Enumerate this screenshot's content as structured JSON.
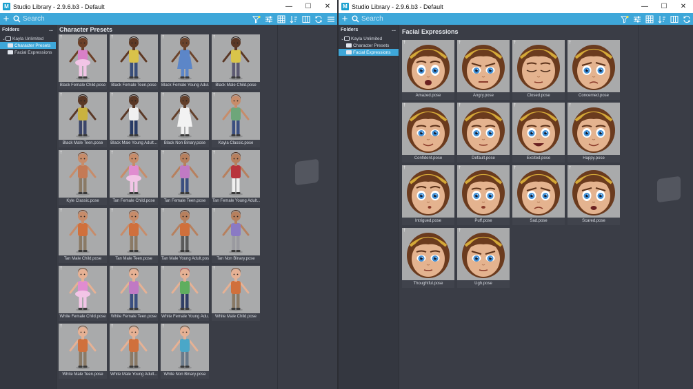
{
  "left_window": {
    "title": "Studio Library - 2.9.6.b3 - Default",
    "app_icon_letter": "M",
    "search_placeholder": "Search",
    "sidebar": {
      "heading": "Folders",
      "more": "...",
      "items": [
        {
          "label": "Kayla Unlimited",
          "expand": "⌄",
          "selected": false
        },
        {
          "label": "Character Presets",
          "selected": true
        },
        {
          "label": "Facial Expressions",
          "selected": false
        }
      ]
    },
    "main_title": "Character Presets",
    "items": [
      {
        "label": "Black Female Child.pose",
        "skin": "#6b3f27",
        "shirt": "#d880c7",
        "pants": "#f2c5e6",
        "hair": "#1a1210",
        "style": "tutu"
      },
      {
        "label": "Black Female Teen.pose",
        "skin": "#5e3823",
        "shirt": "#d9c24a",
        "pants": "#3a4f7a",
        "hair": "#1a1210",
        "style": "plain"
      },
      {
        "label": "Black Female Young Adul...",
        "skin": "#6b432b",
        "shirt": "#5c86c8",
        "pants": "#5c86c8",
        "hair": "#1a1210",
        "style": "dress"
      },
      {
        "label": "Black Male Child.pose",
        "skin": "#5a3826",
        "shirt": "#d9c44a",
        "pants": "#5d5a72",
        "hair": "#1a1210",
        "style": "plain"
      },
      {
        "label": "Black Male Teen.pose",
        "skin": "#5a3826",
        "shirt": "#c9b240",
        "pants": "#3b456a",
        "hair": "#1a1210",
        "style": "plain"
      },
      {
        "label": "Black Male Young Adult...",
        "skin": "#5a3826",
        "shirt": "#f0f0f0",
        "pants": "#283b66",
        "hair": "#1a1210",
        "style": "plain"
      },
      {
        "label": "Black Non Binary.pose",
        "skin": "#63402b",
        "shirt": "#f2f2f2",
        "pants": "#f2f2f2",
        "hair": "#1a1210",
        "style": "dress"
      },
      {
        "label": "Kayla Classic.pose",
        "skin": "#c78c6a",
        "shirt": "#6ea67a",
        "pants": "#3b4f80",
        "hair": "#6a3b22",
        "style": "plain"
      },
      {
        "label": "Kyle Classic.pose",
        "skin": "#c78c6a",
        "shirt": "#c47a56",
        "pants": "#8a7a66",
        "hair": "#6a3b22",
        "style": "plain"
      },
      {
        "label": "Tan Female Child.pose",
        "skin": "#c78c6a",
        "shirt": "#e08cd0",
        "pants": "#f2c5e6",
        "hair": "#6a3b22",
        "style": "tutu"
      },
      {
        "label": "Tan Female Teen.pose",
        "skin": "#b7805e",
        "shirt": "#c07ac4",
        "pants": "#3b4f80",
        "hair": "#5a3421",
        "style": "plain"
      },
      {
        "label": "Tan Female Young Adult...",
        "skin": "#b7805e",
        "shirt": "#b8343c",
        "pants": "#f0f0f0",
        "hair": "#4a2a1a",
        "style": "plain"
      },
      {
        "label": "Tan Male Child.pose",
        "skin": "#c78c6a",
        "shirt": "#d0703c",
        "pants": "#8a7a66",
        "hair": "#6a3b22",
        "style": "plain"
      },
      {
        "label": "Tan Male Teen.pose",
        "skin": "#c78c6a",
        "shirt": "#d0703c",
        "pants": "#8a7a66",
        "hair": "#6a3b22",
        "style": "plain"
      },
      {
        "label": "Tan Male Young Adult.pose",
        "skin": "#b7805e",
        "shirt": "#d0703c",
        "pants": "#5a5a5a",
        "hair": "#4a2a1a",
        "style": "plain"
      },
      {
        "label": "Tan Non Binary.pose",
        "skin": "#b7805e",
        "shirt": "#8a7ac4",
        "pants": "#9a9aa0",
        "hair": "#4a2a1a",
        "style": "plain"
      },
      {
        "label": "White Female Child.pose",
        "skin": "#e6b194",
        "shirt": "#e08cd0",
        "pants": "#f2c5e6",
        "hair": "#7a4a2a",
        "style": "tutu"
      },
      {
        "label": "White Female Teen.pose",
        "skin": "#e6b194",
        "shirt": "#c07ac4",
        "pants": "#3b4f80",
        "hair": "#7a4a2a",
        "style": "plain"
      },
      {
        "label": "White Female Young Adu...",
        "skin": "#e6b194",
        "shirt": "#5fae5f",
        "pants": "#2f3e66",
        "hair": "#c8483c",
        "style": "plain"
      },
      {
        "label": "White Male Child.pose",
        "skin": "#e6b194",
        "shirt": "#d0703c",
        "pants": "#8a7a66",
        "hair": "#7a4a2a",
        "style": "plain"
      },
      {
        "label": "White Male Teen.pose",
        "skin": "#e6b194",
        "shirt": "#d0703c",
        "pants": "#8a7a66",
        "hair": "#7a4a2a",
        "style": "plain"
      },
      {
        "label": "White Male Young Adult...",
        "skin": "#e6b194",
        "shirt": "#d0703c",
        "pants": "#8a7a66",
        "hair": "#7a4a2a",
        "style": "plain"
      },
      {
        "label": "White Non Binary.pose",
        "skin": "#e6b194",
        "shirt": "#4aa7c8",
        "pants": "#6a7a8a",
        "hair": "#7a4a2a",
        "style": "plain"
      }
    ]
  },
  "right_window": {
    "title": "Studio Library - 2.9.6.b3 - Default",
    "app_icon_letter": "M",
    "search_placeholder": "Search",
    "sidebar": {
      "heading": "Folders",
      "more": "...",
      "items": [
        {
          "label": "Kayla Unlimited",
          "expand": "⌄",
          "selected": false
        },
        {
          "label": "Character Presets",
          "selected": false
        },
        {
          "label": "Facial Expressions",
          "selected": true
        }
      ]
    },
    "main_title": "Facial Expressions",
    "items": [
      {
        "label": "Amazed.pose",
        "expr": "amazed"
      },
      {
        "label": "Angry.pose",
        "expr": "angry"
      },
      {
        "label": "Closed.pose",
        "expr": "closed"
      },
      {
        "label": "Concerned.pose",
        "expr": "concerned"
      },
      {
        "label": "Confident.pose",
        "expr": "confident"
      },
      {
        "label": "Default.pose",
        "expr": "default"
      },
      {
        "label": "Excited.pose",
        "expr": "excited"
      },
      {
        "label": "Happy.pose",
        "expr": "happy"
      },
      {
        "label": "Intrigued.pose",
        "expr": "intrigued"
      },
      {
        "label": "Puff.pose",
        "expr": "puff"
      },
      {
        "label": "Sad.pose",
        "expr": "sad"
      },
      {
        "label": "Scared.pose",
        "expr": "scared"
      },
      {
        "label": "Thoughtful.pose",
        "expr": "thoughtful"
      },
      {
        "label": "Ugh.pose",
        "expr": "ugh"
      }
    ]
  },
  "window_controls": {
    "minimize": "—",
    "maximize": "☐",
    "close": "✕"
  },
  "pin_glyph": "†",
  "colors": {
    "accent": "#3ea7d9",
    "panel": "#3a3d46",
    "thumb_bg": "#a9aaab",
    "headband": "#d4a938",
    "eye": "#3f8fd6",
    "face_skin": "#e4b38f",
    "hair": "#6b3b1e"
  }
}
